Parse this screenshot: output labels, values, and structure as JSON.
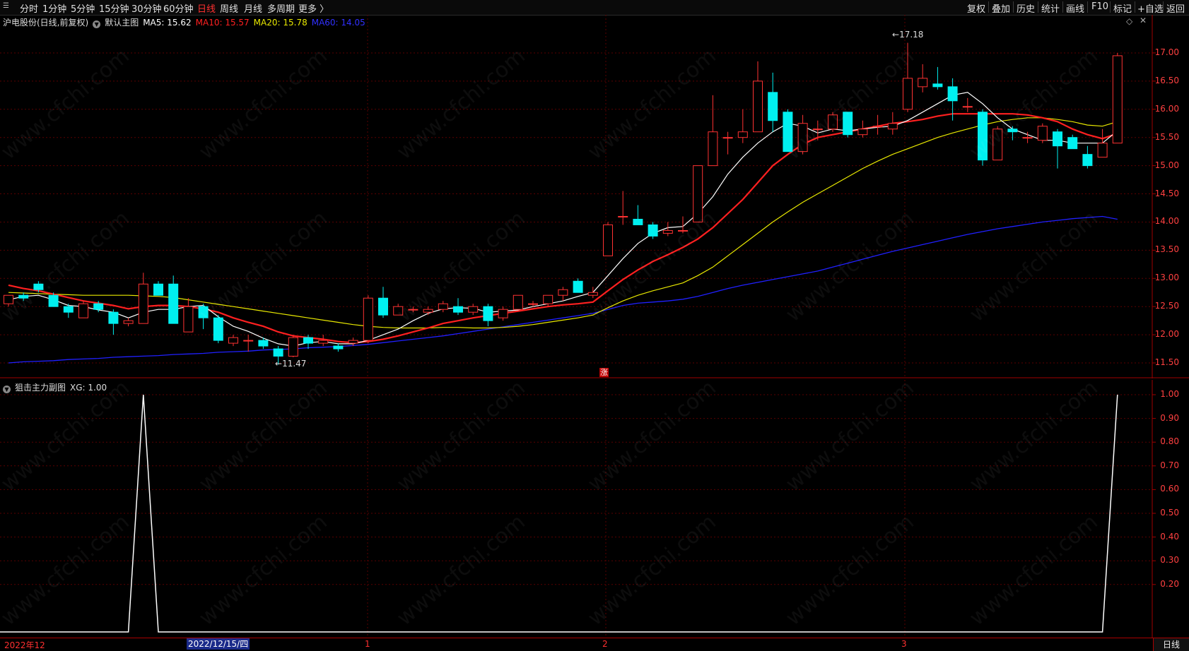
{
  "toolbar": {
    "periods": [
      "分时",
      "1分钟",
      "5分钟",
      "15分钟",
      "30分钟",
      "60分钟",
      "日线",
      "周线",
      "月线",
      "多周期",
      "更多 〉"
    ],
    "active_period": "日线",
    "right_buttons": [
      "复权",
      "叠加",
      "历史",
      "统计",
      "画线",
      "F10",
      "标记",
      "+自选",
      "返回"
    ]
  },
  "main_header": {
    "stock": "沪电股份(日线,前复权)",
    "main_label": "默认主图",
    "ma5": "MA5: 15.62",
    "ma10": "MA10: 15.57",
    "ma20": "MA20: 15.78",
    "ma60": "MA60: 14.05"
  },
  "sub_header": {
    "label": "狙击主力副图",
    "xg": "XG: 1.00"
  },
  "annotations": {
    "high": "17.18",
    "low": "11.47",
    "zhang": "涨"
  },
  "xaxis": {
    "labels": [
      "2022年12",
      "1",
      "2",
      "3"
    ],
    "cursor_date": "2022/12/15/四"
  },
  "day_button": "日线",
  "watermark": "www.cfchi.com",
  "colors": {
    "up": "#ff3232",
    "down": "#00f0f0",
    "ma5": "#ffffff",
    "ma10": "#ff2020",
    "ma20": "#e8e800",
    "ma60": "#2020ff",
    "xg": "#ffffff"
  },
  "chart_data": [
    {
      "type": "candlestick",
      "title": "沪电股份(日线,前复权)",
      "yticks": [
        11.5,
        12.0,
        12.5,
        13.0,
        13.5,
        14.0,
        14.5,
        15.0,
        15.5,
        16.0,
        16.5,
        17.0
      ],
      "ylim": [
        11.35,
        17.3
      ],
      "candles": [
        {
          "o": 12.55,
          "h": 12.7,
          "l": 12.5,
          "c": 12.7
        },
        {
          "o": 12.7,
          "h": 12.75,
          "l": 12.6,
          "c": 12.65
        },
        {
          "o": 12.9,
          "h": 12.95,
          "l": 12.75,
          "c": 12.8
        },
        {
          "o": 12.7,
          "h": 12.75,
          "l": 12.5,
          "c": 12.5
        },
        {
          "o": 12.5,
          "h": 12.55,
          "l": 12.3,
          "c": 12.4
        },
        {
          "o": 12.3,
          "h": 12.6,
          "l": 12.3,
          "c": 12.55
        },
        {
          "o": 12.55,
          "h": 12.6,
          "l": 12.4,
          "c": 12.45
        },
        {
          "o": 12.4,
          "h": 12.45,
          "l": 12.0,
          "c": 12.2
        },
        {
          "o": 12.2,
          "h": 12.3,
          "l": 12.15,
          "c": 12.25
        },
        {
          "o": 12.2,
          "h": 13.1,
          "l": 12.2,
          "c": 12.9
        },
        {
          "o": 12.9,
          "h": 12.95,
          "l": 12.7,
          "c": 12.7
        },
        {
          "o": 12.9,
          "h": 13.05,
          "l": 12.2,
          "c": 12.2
        },
        {
          "o": 12.05,
          "h": 12.65,
          "l": 12.05,
          "c": 12.5
        },
        {
          "o": 12.5,
          "h": 12.55,
          "l": 12.1,
          "c": 12.3
        },
        {
          "o": 12.3,
          "h": 12.35,
          "l": 11.85,
          "c": 11.9
        },
        {
          "o": 11.85,
          "h": 12.0,
          "l": 11.8,
          "c": 11.95
        },
        {
          "o": 11.9,
          "h": 12.0,
          "l": 11.7,
          "c": 11.9
        },
        {
          "o": 11.9,
          "h": 11.95,
          "l": 11.75,
          "c": 11.8
        },
        {
          "o": 11.75,
          "h": 11.8,
          "l": 11.47,
          "c": 11.62
        },
        {
          "o": 11.62,
          "h": 12.0,
          "l": 11.6,
          "c": 11.95
        },
        {
          "o": 11.95,
          "h": 12.0,
          "l": 11.75,
          "c": 11.85
        },
        {
          "o": 11.85,
          "h": 12.0,
          "l": 11.8,
          "c": 11.9
        },
        {
          "o": 11.8,
          "h": 11.85,
          "l": 11.7,
          "c": 11.75
        },
        {
          "o": 11.85,
          "h": 11.95,
          "l": 11.8,
          "c": 11.9
        },
        {
          "o": 11.9,
          "h": 12.7,
          "l": 11.85,
          "c": 12.65
        },
        {
          "o": 12.65,
          "h": 12.85,
          "l": 12.3,
          "c": 12.35
        },
        {
          "o": 12.35,
          "h": 12.55,
          "l": 12.35,
          "c": 12.5
        },
        {
          "o": 12.45,
          "h": 12.5,
          "l": 12.4,
          "c": 12.45
        },
        {
          "o": 12.4,
          "h": 12.5,
          "l": 12.35,
          "c": 12.45
        },
        {
          "o": 12.45,
          "h": 12.6,
          "l": 12.4,
          "c": 12.55
        },
        {
          "o": 12.5,
          "h": 12.65,
          "l": 12.35,
          "c": 12.4
        },
        {
          "o": 12.4,
          "h": 12.55,
          "l": 12.35,
          "c": 12.5
        },
        {
          "o": 12.5,
          "h": 12.55,
          "l": 12.15,
          "c": 12.25
        },
        {
          "o": 12.3,
          "h": 12.5,
          "l": 12.25,
          "c": 12.45
        },
        {
          "o": 12.45,
          "h": 12.7,
          "l": 12.45,
          "c": 12.7
        },
        {
          "o": 12.55,
          "h": 12.6,
          "l": 12.5,
          "c": 12.55
        },
        {
          "o": 12.55,
          "h": 12.7,
          "l": 12.5,
          "c": 12.7
        },
        {
          "o": 12.7,
          "h": 12.85,
          "l": 12.6,
          "c": 12.8
        },
        {
          "o": 12.95,
          "h": 13.0,
          "l": 12.75,
          "c": 12.75
        },
        {
          "o": 12.7,
          "h": 12.85,
          "l": 12.65,
          "c": 12.75
        },
        {
          "o": 13.4,
          "h": 14.0,
          "l": 13.4,
          "c": 13.95
        },
        {
          "o": 14.1,
          "h": 14.55,
          "l": 13.95,
          "c": 14.1
        },
        {
          "o": 14.05,
          "h": 14.3,
          "l": 13.95,
          "c": 13.95
        },
        {
          "o": 13.95,
          "h": 14.0,
          "l": 13.7,
          "c": 13.75
        },
        {
          "o": 13.8,
          "h": 14.0,
          "l": 13.75,
          "c": 13.85
        },
        {
          "o": 13.85,
          "h": 14.1,
          "l": 13.8,
          "c": 13.85
        },
        {
          "o": 14.0,
          "h": 15.0,
          "l": 14.0,
          "c": 15.0
        },
        {
          "o": 15.0,
          "h": 16.25,
          "l": 15.0,
          "c": 15.6
        },
        {
          "o": 15.5,
          "h": 15.6,
          "l": 15.2,
          "c": 15.5
        },
        {
          "o": 15.5,
          "h": 16.0,
          "l": 15.4,
          "c": 15.6
        },
        {
          "o": 15.6,
          "h": 16.85,
          "l": 15.6,
          "c": 16.5
        },
        {
          "o": 16.3,
          "h": 16.65,
          "l": 15.6,
          "c": 15.8
        },
        {
          "o": 15.95,
          "h": 16.0,
          "l": 15.3,
          "c": 15.25
        },
        {
          "o": 15.25,
          "h": 15.9,
          "l": 15.2,
          "c": 15.75
        },
        {
          "o": 15.65,
          "h": 15.8,
          "l": 15.45,
          "c": 15.65
        },
        {
          "o": 15.65,
          "h": 15.95,
          "l": 15.6,
          "c": 15.9
        },
        {
          "o": 15.95,
          "h": 15.95,
          "l": 15.5,
          "c": 15.55
        },
        {
          "o": 15.55,
          "h": 15.8,
          "l": 15.5,
          "c": 15.65
        },
        {
          "o": 15.7,
          "h": 15.9,
          "l": 15.55,
          "c": 15.7
        },
        {
          "o": 15.65,
          "h": 15.95,
          "l": 15.55,
          "c": 15.75
        },
        {
          "o": 16.0,
          "h": 17.18,
          "l": 15.95,
          "c": 16.55
        },
        {
          "o": 16.4,
          "h": 16.8,
          "l": 16.3,
          "c": 16.55
        },
        {
          "o": 16.45,
          "h": 16.75,
          "l": 16.35,
          "c": 16.4
        },
        {
          "o": 16.4,
          "h": 16.55,
          "l": 15.8,
          "c": 16.15
        },
        {
          "o": 16.05,
          "h": 16.2,
          "l": 15.95,
          "c": 16.05
        },
        {
          "o": 15.95,
          "h": 16.0,
          "l": 15.0,
          "c": 15.1
        },
        {
          "o": 15.1,
          "h": 15.7,
          "l": 15.1,
          "c": 15.65
        },
        {
          "o": 15.65,
          "h": 15.7,
          "l": 15.45,
          "c": 15.6
        },
        {
          "o": 15.5,
          "h": 15.6,
          "l": 15.4,
          "c": 15.5
        },
        {
          "o": 15.45,
          "h": 15.75,
          "l": 15.4,
          "c": 15.7
        },
        {
          "o": 15.6,
          "h": 15.65,
          "l": 14.95,
          "c": 15.35
        },
        {
          "o": 15.5,
          "h": 15.55,
          "l": 15.3,
          "c": 15.3
        },
        {
          "o": 15.2,
          "h": 15.35,
          "l": 14.95,
          "c": 15.0
        },
        {
          "o": 15.15,
          "h": 15.65,
          "l": 15.15,
          "c": 15.4
        },
        {
          "o": 15.4,
          "h": 17.0,
          "l": 15.4,
          "c": 16.95
        }
      ],
      "ma5": [
        12.62,
        12.68,
        12.7,
        12.62,
        12.52,
        12.5,
        12.44,
        12.4,
        12.3,
        12.4,
        12.45,
        12.45,
        12.5,
        12.52,
        12.32,
        12.15,
        12.06,
        11.94,
        11.84,
        11.8,
        11.86,
        11.88,
        11.84,
        11.84,
        11.9,
        12.0,
        12.1,
        12.25,
        12.38,
        12.46,
        12.48,
        12.47,
        12.4,
        12.42,
        12.44,
        12.5,
        12.55,
        12.6,
        12.68,
        12.75,
        13.05,
        13.35,
        13.62,
        13.8,
        13.9,
        13.92,
        14.15,
        14.45,
        14.85,
        15.15,
        15.4,
        15.6,
        15.75,
        15.7,
        15.58,
        15.65,
        15.62,
        15.65,
        15.68,
        15.7,
        15.8,
        15.95,
        16.1,
        16.25,
        16.3,
        16.1,
        15.85,
        15.65,
        15.55,
        15.45,
        15.45,
        15.4,
        15.4,
        15.4,
        15.62
      ],
      "ma10": [
        12.88,
        12.82,
        12.78,
        12.72,
        12.66,
        12.6,
        12.56,
        12.52,
        12.46,
        12.5,
        12.52,
        12.52,
        12.5,
        12.46,
        12.4,
        12.3,
        12.22,
        12.15,
        12.05,
        11.98,
        11.95,
        11.92,
        11.88,
        11.86,
        11.88,
        11.92,
        11.98,
        12.05,
        12.12,
        12.2,
        12.25,
        12.3,
        12.34,
        12.38,
        12.42,
        12.46,
        12.5,
        12.53,
        12.55,
        12.58,
        12.78,
        12.98,
        13.15,
        13.3,
        13.42,
        13.55,
        13.7,
        13.9,
        14.15,
        14.4,
        14.7,
        15.0,
        15.2,
        15.38,
        15.5,
        15.55,
        15.6,
        15.65,
        15.7,
        15.75,
        15.78,
        15.82,
        15.88,
        15.92,
        15.92,
        15.92,
        15.92,
        15.92,
        15.9,
        15.85,
        15.78,
        15.65,
        15.55,
        15.48,
        15.57
      ],
      "ma20": [
        12.75,
        12.74,
        12.73,
        12.72,
        12.71,
        12.7,
        12.7,
        12.7,
        12.7,
        12.69,
        12.68,
        12.66,
        12.62,
        12.58,
        12.54,
        12.5,
        12.46,
        12.42,
        12.38,
        12.34,
        12.3,
        12.26,
        12.22,
        12.18,
        12.15,
        12.13,
        12.12,
        12.12,
        12.12,
        12.13,
        12.13,
        12.12,
        12.12,
        12.13,
        12.15,
        12.18,
        12.22,
        12.26,
        12.3,
        12.35,
        12.48,
        12.6,
        12.7,
        12.78,
        12.85,
        12.92,
        13.05,
        13.2,
        13.4,
        13.6,
        13.8,
        14.0,
        14.18,
        14.35,
        14.5,
        14.65,
        14.8,
        14.95,
        15.08,
        15.2,
        15.3,
        15.4,
        15.5,
        15.58,
        15.65,
        15.72,
        15.78,
        15.82,
        15.85,
        15.85,
        15.82,
        15.78,
        15.72,
        15.7,
        15.78
      ],
      "ma60": [
        11.5,
        11.52,
        11.53,
        11.54,
        11.56,
        11.57,
        11.58,
        11.6,
        11.61,
        11.62,
        11.63,
        11.65,
        11.66,
        11.67,
        11.69,
        11.7,
        11.71,
        11.73,
        11.74,
        11.75,
        11.77,
        11.78,
        11.79,
        11.81,
        11.83,
        11.86,
        11.89,
        11.92,
        11.95,
        11.98,
        12.02,
        12.06,
        12.1,
        12.14,
        12.18,
        12.22,
        12.26,
        12.3,
        12.34,
        12.38,
        12.45,
        12.52,
        12.56,
        12.58,
        12.6,
        12.63,
        12.68,
        12.75,
        12.82,
        12.88,
        12.93,
        12.98,
        13.03,
        13.08,
        13.13,
        13.2,
        13.27,
        13.34,
        13.41,
        13.48,
        13.54,
        13.6,
        13.66,
        13.72,
        13.78,
        13.83,
        13.88,
        13.92,
        13.96,
        14.0,
        14.03,
        14.06,
        14.08,
        14.1,
        14.05
      ]
    },
    {
      "type": "line",
      "title": "狙击主力副图",
      "series_name": "XG",
      "yticks": [
        0.2,
        0.3,
        0.4,
        0.5,
        0.6,
        0.7,
        0.8,
        0.9,
        1.0
      ],
      "ylim": [
        0,
        1.0
      ],
      "values": [
        0,
        0,
        0,
        0,
        0,
        0,
        0,
        0,
        0,
        1,
        0,
        0,
        0,
        0,
        0,
        0,
        0,
        0,
        0,
        0,
        0,
        0,
        0,
        0,
        0,
        0,
        0,
        0,
        0,
        0,
        0,
        0,
        0,
        0,
        0,
        0,
        0,
        0,
        0,
        0,
        0,
        0,
        0,
        0,
        0,
        0,
        0,
        0,
        0,
        0,
        0,
        0,
        0,
        0,
        0,
        0,
        0,
        0,
        0,
        0,
        0,
        0,
        0,
        0,
        0,
        0,
        0,
        0,
        0,
        0,
        0,
        0,
        0,
        0,
        1
      ]
    }
  ]
}
